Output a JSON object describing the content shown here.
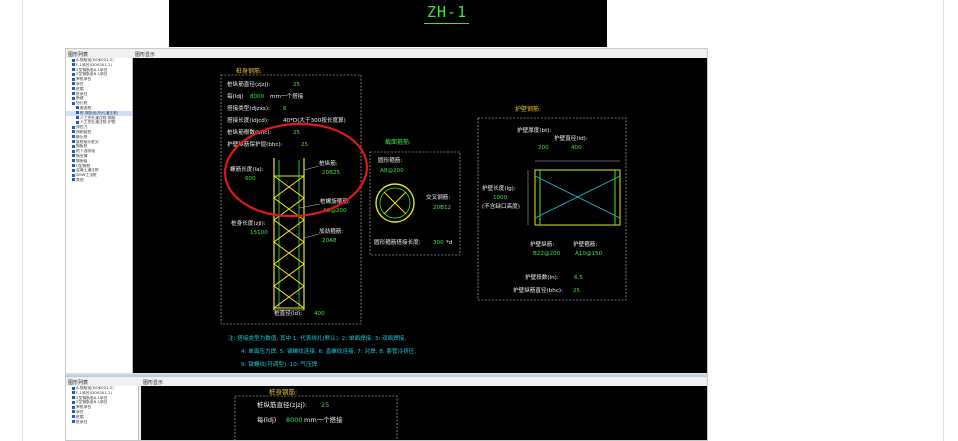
{
  "top_strip": {
    "label": "ZH-1"
  },
  "panel1": {
    "tree_title": "图形列表",
    "canvas_title": "图形显示",
    "tree_items": [
      "A-钢筋笼(DOK001-2)",
      "F-1承台(DOK001-2)",
      "2型钢筋笼A-1承台",
      "2型钢筋笼B-1承台",
      "单桩承台",
      "承台",
      "桩帽",
      "桩承台",
      "新建",
      "钻孔桩",
      "截面桩",
      "桩 钢筋笼(钻孔灌注桩)",
      "人工挖孔灌注桩-钢筋",
      "人工挖孔灌注桩-护壁",
      "预应力",
      "预制管桩",
      "静压桩",
      "管桩接头桩尖",
      "钢板桩",
      "地下连续墙",
      "钢支撑",
      "钢围檩",
      "H型钢桩",
      "混凝土灌注桩",
      "SMW工法桩",
      "其他"
    ]
  },
  "drawing": {
    "body_title": "桩身钢筋:",
    "props": [
      {
        "label": "桩纵筋直径(zjzj):",
        "value": "25"
      },
      {
        "label": "每(ldj)",
        "value": "8000",
        "suffix": "mm一个搭接"
      },
      {
        "label": "搭接类型(djzxs):",
        "value": "6"
      },
      {
        "label": "搭接长度(ldjcd):",
        "value": "40*D(大于300按长度算)"
      },
      {
        "label": "桩纵筋根数(bhc):",
        "value": "25"
      },
      {
        "label": "护壁纵筋保护层(bhc):",
        "value": "25"
      }
    ],
    "dense_len_label": "螺筋长度(la):",
    "dense_len_value": "600",
    "long_bar_label": "桩纵筋:",
    "long_bar_value": "20B25",
    "spiral_label": "桩螺旋箍筋:",
    "spiral_value": "A8@200",
    "pile_len_label": "桩身长度(zjl):",
    "pile_len_value": "15100",
    "stiff_label": "加劲箍筋:",
    "stiff_value": "20A8",
    "diameter_label": "桩直径(ld):",
    "diameter_value": "400",
    "section_title": "截面箍筋:",
    "ring_label": "圆形箍筋:",
    "ring_value": "A8@200",
    "cross_label": "交叉钢筋:",
    "cross_value": "20B12",
    "ring_lap_label": "圆形箍筋搭接长度:",
    "ring_lap_value": "300",
    "ring_lap_suffix": "*d",
    "wall_title": "护壁钢筋:",
    "wall_thick_label": "护壁厚度(bt):",
    "wall_thick_value": "200",
    "wall_dia_label": "护壁直径(ld):",
    "wall_dia_value": "400",
    "wall_len_label": "护壁长度(lg):",
    "wall_len_value": "1000",
    "wall_len_note": "(不含缺口高度)",
    "wall_long_label": "护壁纵筋:",
    "wall_long_value": "B22@200",
    "wall_hoop_label": "护壁箍筋:",
    "wall_hoop_value": "A10@150",
    "wall_seg_label": "护壁段数(ln):",
    "wall_seg_value": "6.5",
    "wall_cover_label": "护壁纵筋直径(bhc):",
    "wall_cover_value": "25",
    "note1": "注: 搭接类型为数值, 其中 1: 代表绑扎(默认), 2: 单面焊接, 3: 双面焊接,",
    "note2": "4: 单面压力焊, 5: 锥螺纹连接, 6: 直螺纹连接, 7: 对焊, 8: 套管冷挤压,",
    "note3": "9: 镦螺纹(可调型), 10: 气压焊"
  },
  "panel2": {
    "tree_title": "图形列表",
    "canvas_title": "图形显示",
    "tree_items": [
      "A-钢筋笼(DOK001-2)",
      "F-1承台(DOK001-2)",
      "2型钢筋笼A-1承台",
      "2型钢筋笼B-1承台",
      "单桩承台",
      "承台",
      "桩帽",
      "桩承台"
    ],
    "body_title": "桩身钢筋:",
    "prop1_label": "桩纵筋直径(zjzj):",
    "prop1_value": "25",
    "prop2_label": "每(ldj)",
    "prop2_value": "8000",
    "prop2_suffix": "mm一个搭接"
  },
  "colors": {
    "green": "#3ee43e",
    "yellow": "#e8e818",
    "cyan": "#19c7d6",
    "red": "#e01818",
    "white": "#f2f2f2",
    "orange": "#e8c22a"
  }
}
